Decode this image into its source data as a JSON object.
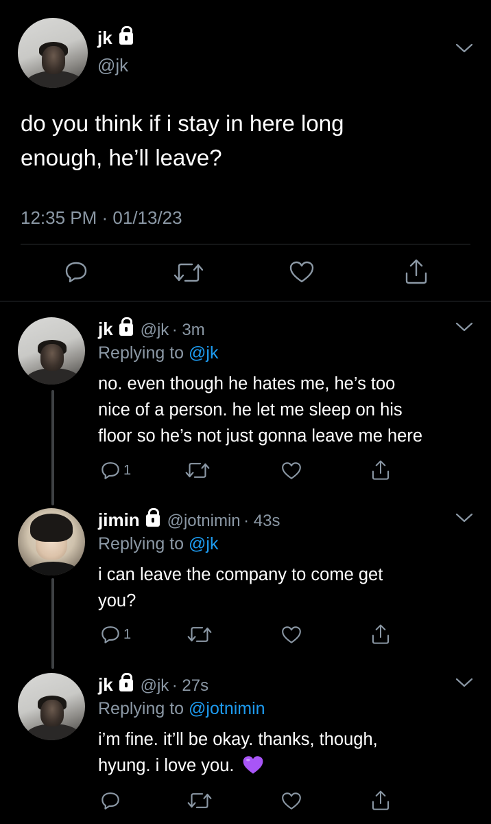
{
  "main_tweet": {
    "name": "jk",
    "handle": "@jk",
    "text_line1": "do you think if i stay in here long",
    "text_line2": "enough, he’ll leave?",
    "timestamp": "12:35 PM · 01/13/23",
    "icons": [
      "reply-icon",
      "retweet-icon",
      "like-icon",
      "share-icon"
    ]
  },
  "replies": [
    {
      "name": "jk",
      "handle": "@jk",
      "time": "· 3m",
      "replying_prefix": "Replying to",
      "replying_to": "@jk",
      "lines": [
        "no. even though he hates me, he’s too",
        "nice of a person. he let me sleep on his",
        "floor so he’s not just gonna leave me here"
      ],
      "reply_count": "1"
    },
    {
      "name": "jimin",
      "handle": "@jotnimin",
      "time": "· 43s",
      "replying_prefix": "Replying to",
      "replying_to": "@jk",
      "lines": [
        "i can leave the company to come get",
        "you?"
      ],
      "reply_count": "1"
    },
    {
      "name": "jk",
      "handle": "@jk",
      "time": "· 27s",
      "replying_prefix": "Replying to",
      "replying_to": "@jotnimin",
      "lines": [
        "i’m fine. it’ll be okay. thanks, though,",
        "hyung. i love you."
      ],
      "emoji": "💜",
      "reply_count": ""
    }
  ],
  "colors": {
    "background": "#000000",
    "text": "#ffffff",
    "secondary": "#8b98a5",
    "link": "#1d9bf0",
    "heart_emoji": "#a855f7"
  }
}
